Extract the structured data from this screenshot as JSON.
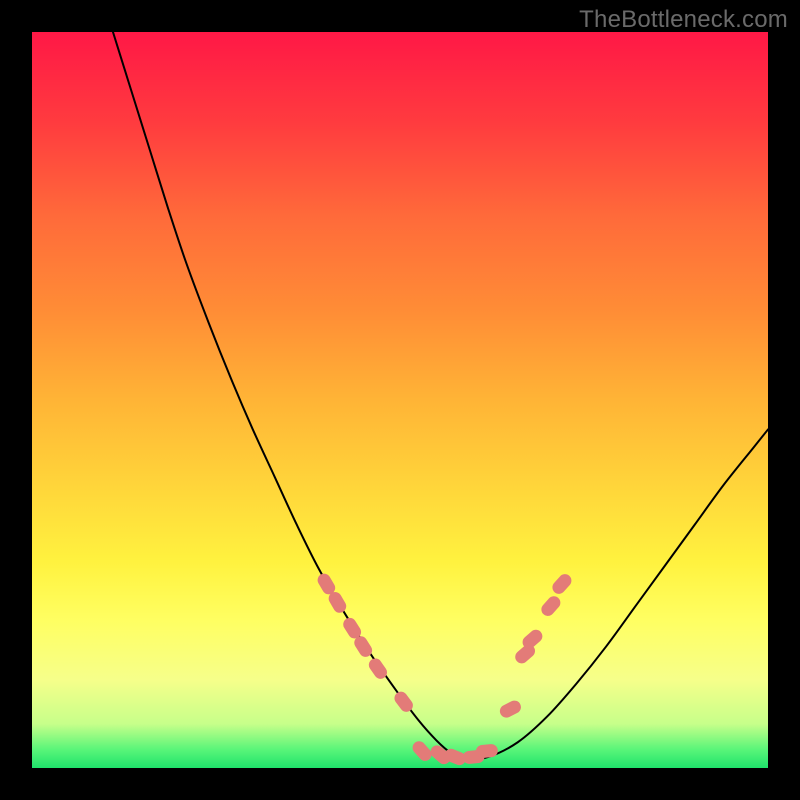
{
  "watermark": "TheBottleneck.com",
  "chart_data": {
    "type": "line",
    "title": "",
    "xlabel": "",
    "ylabel": "",
    "xlim": [
      0,
      100
    ],
    "ylim": [
      0,
      100
    ],
    "grid": false,
    "legend": false,
    "background": {
      "type": "vertical-gradient",
      "stops": [
        {
          "pos": 0.0,
          "color": "#ff1846"
        },
        {
          "pos": 0.12,
          "color": "#ff3a3f"
        },
        {
          "pos": 0.25,
          "color": "#ff6a3a"
        },
        {
          "pos": 0.38,
          "color": "#ff8d36"
        },
        {
          "pos": 0.5,
          "color": "#ffb436"
        },
        {
          "pos": 0.62,
          "color": "#ffd63a"
        },
        {
          "pos": 0.72,
          "color": "#fff23f"
        },
        {
          "pos": 0.8,
          "color": "#ffff62"
        },
        {
          "pos": 0.88,
          "color": "#f6ff8a"
        },
        {
          "pos": 0.94,
          "color": "#c7ff8a"
        },
        {
          "pos": 0.975,
          "color": "#59f579"
        },
        {
          "pos": 1.0,
          "color": "#1fe36b"
        }
      ]
    },
    "series": [
      {
        "name": "bottleneck-curve",
        "stroke": "#000000",
        "stroke_width": 2,
        "x": [
          11.0,
          13.5,
          16.0,
          18.5,
          21.0,
          24.0,
          27.0,
          30.0,
          33.0,
          36.0,
          39.0,
          42.5,
          46.0,
          49.5,
          52.5,
          55.0,
          57.0,
          59.0,
          62.0,
          66.0,
          70.0,
          74.0,
          78.0,
          82.0,
          86.0,
          90.0,
          94.0,
          98.0,
          100.0
        ],
        "y": [
          100.0,
          92.0,
          84.0,
          76.0,
          68.5,
          60.5,
          53.0,
          46.0,
          39.5,
          33.0,
          27.0,
          21.0,
          15.5,
          10.5,
          6.5,
          3.7,
          2.0,
          1.2,
          1.5,
          3.5,
          7.0,
          11.5,
          16.5,
          22.0,
          27.5,
          33.0,
          38.5,
          43.5,
          46.0
        ]
      }
    ],
    "markers": {
      "name": "highlight-dots",
      "shape": "rounded-capsule",
      "color": "#e37b78",
      "points": [
        {
          "x": 40.0,
          "y": 25.0
        },
        {
          "x": 41.5,
          "y": 22.5
        },
        {
          "x": 43.5,
          "y": 19.0
        },
        {
          "x": 45.0,
          "y": 16.5
        },
        {
          "x": 47.0,
          "y": 13.5
        },
        {
          "x": 50.5,
          "y": 9.0
        },
        {
          "x": 53.0,
          "y": 2.3
        },
        {
          "x": 55.5,
          "y": 1.8
        },
        {
          "x": 57.5,
          "y": 1.5
        },
        {
          "x": 60.0,
          "y": 1.5
        },
        {
          "x": 61.8,
          "y": 2.3
        },
        {
          "x": 65.0,
          "y": 8.0
        },
        {
          "x": 67.0,
          "y": 15.5
        },
        {
          "x": 68.0,
          "y": 17.5
        },
        {
          "x": 70.5,
          "y": 22.0
        },
        {
          "x": 72.0,
          "y": 25.0
        }
      ]
    }
  }
}
